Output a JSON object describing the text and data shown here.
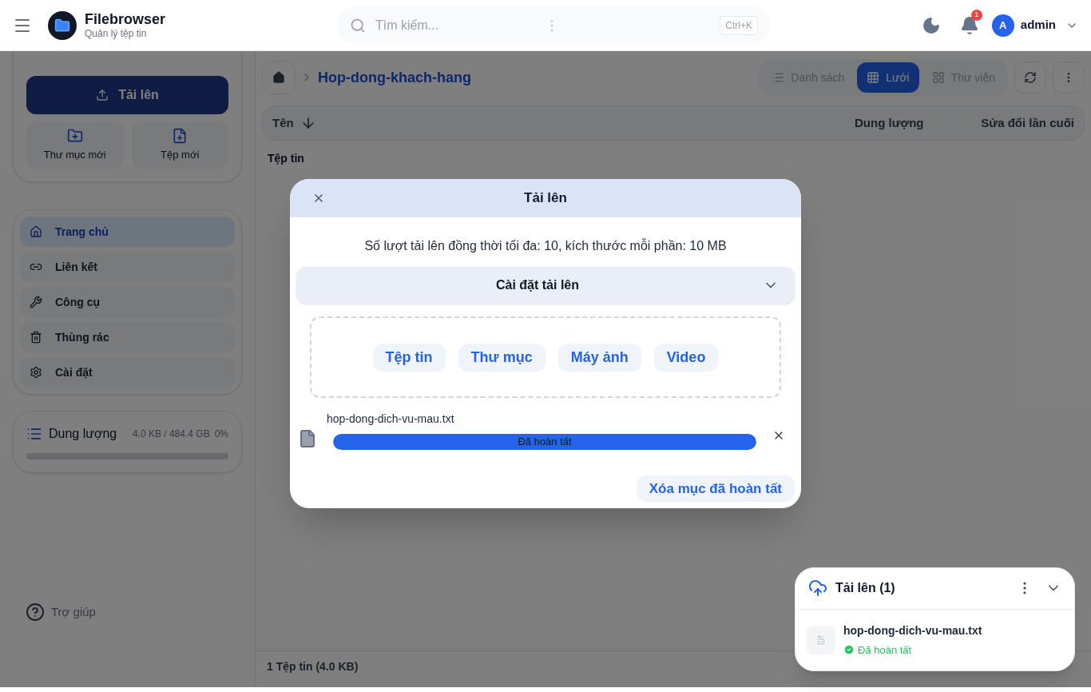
{
  "header": {
    "title": "Filebrowser",
    "subtitle": "Quản lý tệp tin",
    "search_placeholder": "Tìm kiếm...",
    "shortcut": "Ctrl+K",
    "notification_count": "1",
    "user": {
      "initial": "A",
      "name": "admin"
    }
  },
  "sidebar": {
    "upload_button": "Tải lên",
    "actions": [
      {
        "kind": "folder",
        "label": "Thư mục mới"
      },
      {
        "kind": "file",
        "label": "Tệp mới"
      }
    ],
    "nav": [
      {
        "kind": "home",
        "label": "Trang chủ",
        "selected": true
      },
      {
        "kind": "link",
        "label": "Liên kết",
        "selected": false
      },
      {
        "kind": "tools",
        "label": "Công cụ",
        "selected": false
      },
      {
        "kind": "trash",
        "label": "Thùng rác",
        "selected": false
      },
      {
        "kind": "settings",
        "label": "Cài đặt",
        "selected": false
      }
    ],
    "storage": {
      "label": "Dung lượng",
      "usage": "4.0 KB / 484.4 GB",
      "percent": "0%",
      "level": 0
    },
    "help": "Trợ giúp"
  },
  "main": {
    "breadcrumb": [
      "Hop-dong-khach-hang"
    ],
    "views": [
      {
        "kind": "list",
        "label": "Danh sách",
        "selected": false
      },
      {
        "kind": "grid",
        "label": "Lưới",
        "selected": true
      },
      {
        "kind": "gallery",
        "label": "Thư viện",
        "selected": false
      }
    ],
    "columns": [
      {
        "label": "Tên",
        "sorted": true
      },
      {
        "label": "Dung lượng",
        "sorted": false
      },
      {
        "label": "Sửa đổi lần cuối",
        "sorted": false
      }
    ],
    "section_label": "Tệp tin",
    "status": "1 Tệp tin (4.0 KB)"
  },
  "dialog": {
    "title": "Tải lên",
    "info": "Số lượt tải lên đồng thời tối đa: 10, kích thước mỗi phần: 10 MB",
    "settings_label": "Cài đặt tải lên",
    "settings_expanded": false,
    "sources": [
      "Tệp tin",
      "Thư mục",
      "Máy ảnh",
      "Video"
    ],
    "files": [
      {
        "name": "hop-dong-dich-vu-mau.txt",
        "status": "Đã hoàn tất",
        "level": 1
      }
    ],
    "clear_button": "Xóa mục đã hoàn tất"
  },
  "upload_panel": {
    "title": "Tải lên (1)",
    "files": [
      {
        "name": "hop-dong-dich-vu-mau.txt",
        "status": "Đã hoàn tất"
      }
    ]
  }
}
